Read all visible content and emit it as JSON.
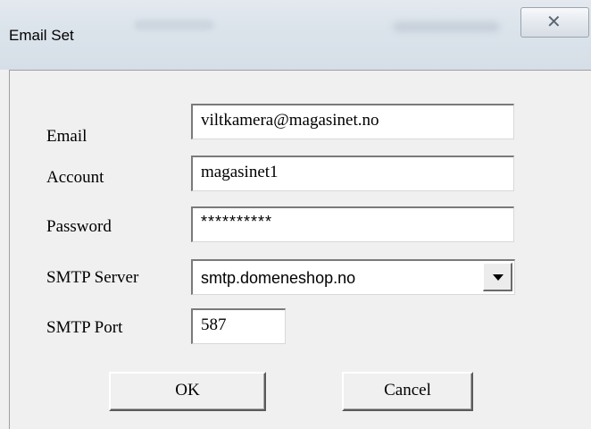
{
  "window": {
    "title": "Email Set"
  },
  "form": {
    "email": {
      "label": "Email",
      "value": "viltkamera@magasinet.no"
    },
    "account": {
      "label": "Account",
      "value": "magasinet1"
    },
    "password": {
      "label": "Password",
      "value": "**********"
    },
    "smtp_server": {
      "label": "SMTP Server",
      "value": "smtp.domeneshop.no"
    },
    "smtp_port": {
      "label": "SMTP Port",
      "value": "587"
    }
  },
  "buttons": {
    "ok_label": "OK",
    "cancel_label": "Cancel"
  },
  "icons": {
    "close": "close-icon",
    "dropdown": "chevron-down-icon"
  }
}
